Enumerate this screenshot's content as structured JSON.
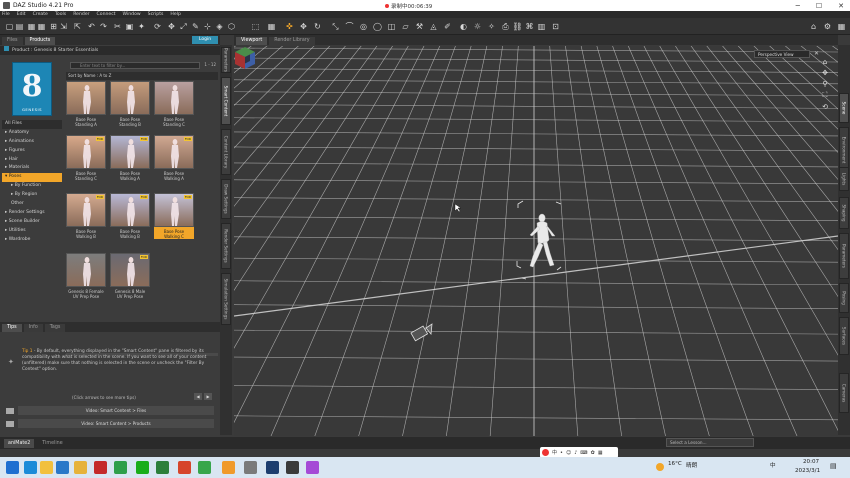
{
  "window": {
    "title": "DAZ Studio 4.21 Pro",
    "recording": "录制中00:06:39"
  },
  "menu": [
    "File",
    "Edit",
    "Create",
    "Tools",
    "Render",
    "Connect",
    "Window",
    "Scripts",
    "Help"
  ],
  "left_panel": {
    "tabs": [
      "Files",
      "Products"
    ],
    "login_label": "Login",
    "product_title": "Product : Genesis 8 Starter Essentials",
    "product_thumb_label": "GENESIS",
    "filter_placeholder": "Enter text to filter by...",
    "item_count": "1 - 12",
    "sort_label": "Sort by Name : A to Z",
    "categories": [
      {
        "label": "All Files",
        "type": "allfiles"
      },
      {
        "label": "▸ Anatomy",
        "type": ""
      },
      {
        "label": "▸ Animations",
        "type": ""
      },
      {
        "label": "▸ Figures",
        "type": ""
      },
      {
        "label": "▸ Hair",
        "type": ""
      },
      {
        "label": "▸ Materials",
        "type": ""
      },
      {
        "label": "▾ Poses",
        "type": "sel"
      },
      {
        "label": "▸ By Function",
        "type": "sub"
      },
      {
        "label": "▸ By Region",
        "type": "sub"
      },
      {
        "label": "Other",
        "type": "sub"
      },
      {
        "label": "▸ Render Settings",
        "type": ""
      },
      {
        "label": "▸ Scene Builder",
        "type": ""
      },
      {
        "label": "▸ Utilities",
        "type": ""
      },
      {
        "label": "▸ Wardrobe",
        "type": ""
      }
    ],
    "items": [
      {
        "line1": "Base Pose",
        "line2": "Standing A",
        "badge": "",
        "selected": false,
        "bg": "#c9a07e"
      },
      {
        "line1": "Base Pose",
        "line2": "Standing B",
        "badge": "",
        "selected": false,
        "bg": "#c49c7c"
      },
      {
        "line1": "Base Pose",
        "line2": "Standing C",
        "badge": "",
        "selected": false,
        "bg": "#b9a0a0"
      },
      {
        "line1": "Base Pose",
        "line2": "Standing C",
        "badge": "FOR",
        "selected": false,
        "bg": "#d8a98a"
      },
      {
        "line1": "Base Pose",
        "line2": "Walking A",
        "badge": "FOR",
        "selected": false,
        "bg": "#b3b6d4"
      },
      {
        "line1": "Base Pose",
        "line2": "Walking A",
        "badge": "FOR",
        "selected": false,
        "bg": "#d0a892"
      },
      {
        "line1": "Base Pose",
        "line2": "Walking B",
        "badge": "FOR",
        "selected": false,
        "bg": "#d4aa90"
      },
      {
        "line1": "Base Pose",
        "line2": "Walking B",
        "badge": "FOR",
        "selected": false,
        "bg": "#b8b8d6"
      },
      {
        "line1": "Base Pose",
        "line2": "Walking C",
        "badge": "FOR",
        "selected": true,
        "bg": "#c4c2d8"
      },
      {
        "line1": "Genesis 8 Female",
        "line2": "UV Prep Pose",
        "badge": "",
        "selected": false,
        "bg": "#7d7d7d"
      },
      {
        "line1": "Genesis 8 Male",
        "line2": "UV Prep Pose",
        "badge": "FOR",
        "selected": false,
        "bg": "#6a6a72"
      }
    ],
    "tip_tabs": [
      "Tips",
      "Info",
      "Tags"
    ],
    "tip_title": "Tip 1",
    "tip_body": " - By default, everything displayed in the \"Smart Content\" pane is filtered by its compatibility with what is selected in the scene. If you want to see all of your content (unfiltered) make sure that nothing is selected in the scene or uncheck the \"Filter By Context\" option.",
    "click_arrows": "(Click arrows to see more tips)",
    "video1": "Video: Smart Content > Files",
    "video2": "Video: Smart Content > Products"
  },
  "vertical_tabs_left": [
    "Parameters",
    "Smart Content",
    "Content Library",
    "Draw Settings",
    "Render Settings",
    "Simulation Settings"
  ],
  "vertical_tabs_right": [
    "Scene",
    "Environment",
    "Lights",
    "Shaping",
    "Parameters",
    "Posing",
    "Surfaces",
    "Cameras"
  ],
  "viewport": {
    "tabs": [
      "Viewport",
      "Render Library"
    ],
    "camera": "Perspective View"
  },
  "bottom": {
    "tabs": [
      "aniMate2",
      "Timeline"
    ],
    "lesson_placeholder": "Select a Lesson..."
  },
  "taskbar": {
    "temp": "16°C",
    "weather": "晴朗",
    "ime": "中",
    "time": "20:07",
    "date": "2023/3/1"
  },
  "colors": {
    "accent": "#f2a629",
    "login": "#2f8fb0",
    "viewport_bg": "#393939",
    "grid": "#cfcfcf"
  }
}
